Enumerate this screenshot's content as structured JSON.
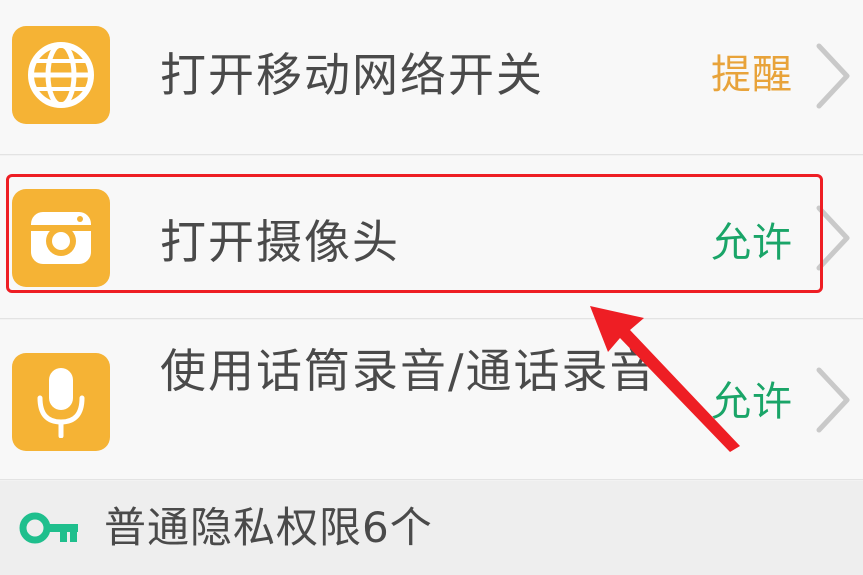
{
  "permissions": [
    {
      "label": "打开移动网络开关",
      "status": "提醒",
      "icon": "globe-icon"
    },
    {
      "label": "打开摄像头",
      "status": "允许",
      "icon": "camera-icon"
    },
    {
      "label": "使用话筒录音/通话录音",
      "status": "允许",
      "icon": "microphone-icon"
    }
  ],
  "footer": {
    "label": "普通隐私权限6个",
    "icon": "key-icon"
  },
  "colors": {
    "icon_tile": "#f5b335",
    "status_remind": "#e8a33a",
    "status_allow": "#1aa568",
    "key": "#1fbf8d",
    "highlight": "#ee1e24"
  }
}
